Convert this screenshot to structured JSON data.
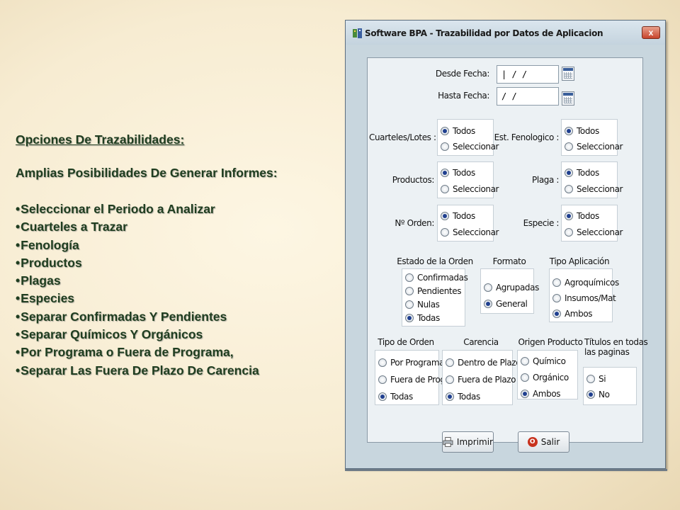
{
  "slide": {
    "title": "Opciones De Trazabilidades:",
    "subtitle": "Amplias Posibilidades De Generar Informes:",
    "bullet_char": "•",
    "bullets": [
      "Seleccionar el Periodo a Analizar",
      "Cuarteles a Trazar",
      "Fenología",
      "Productos",
      "Plagas",
      "Especies",
      "Separar Confirmadas Y Pendientes",
      "Separar Químicos Y Orgánicos",
      "Por Programa o Fuera de Programa,",
      "Separar Las Fuera De Plazo De Carencia"
    ]
  },
  "window": {
    "title": "Software BPA - Trazabilidad por Datos de Aplicacion",
    "close_label": "x",
    "desde_label": "Desde Fecha:",
    "desde_value": "| / /",
    "hasta_label": "Hasta Fecha:",
    "hasta_value": "/ /",
    "cuarteles_label": "Cuarteles/Lotes :",
    "est_fenologico_label": "Est. Fenologico :",
    "productos_label": "Productos:",
    "plaga_label": "Plaga :",
    "norden_label": "Nº Orden:",
    "especie_label": "Especie :",
    "opt_todos": "Todos",
    "opt_seleccionar": "Seleccionar",
    "estado_title": "Estado de la Orden",
    "estado_options": [
      "Confirmadas",
      "Pendientes",
      "Nulas",
      "Todas"
    ],
    "formato_title": "Formato",
    "formato_options": [
      "Agrupadas",
      "General"
    ],
    "tipo_aplicacion_title": "Tipo Aplicación",
    "tipo_aplicacion_options": [
      "Agroquímicos",
      "Insumos/Mat",
      "Ambos"
    ],
    "tipo_orden_title": "Tipo  de Orden",
    "tipo_orden_options": [
      "Por Programa",
      "Fuera de Prog",
      "Todas"
    ],
    "carencia_title": "Carencia",
    "carencia_options": [
      "Dentro de Plazo",
      "Fuera de Plazo",
      "Todas"
    ],
    "origen_title": "Origen Producto",
    "origen_options": [
      "Químico",
      "Orgánico",
      "Ambos"
    ],
    "titulos_title_1": "Títulos en todas",
    "titulos_title_2": "las paginas",
    "titulos_options": [
      "Si",
      "No"
    ],
    "imprimir_label": "Imprimir",
    "salir_label": "Salir",
    "exit_glyph": "O"
  },
  "colors": {
    "slide_text": "#1f3d1f",
    "window_bg": "#c8d6de",
    "client_bg": "#ecf1f4",
    "radio_selected": "#1f3f8f",
    "close_button": "#c8442c"
  }
}
